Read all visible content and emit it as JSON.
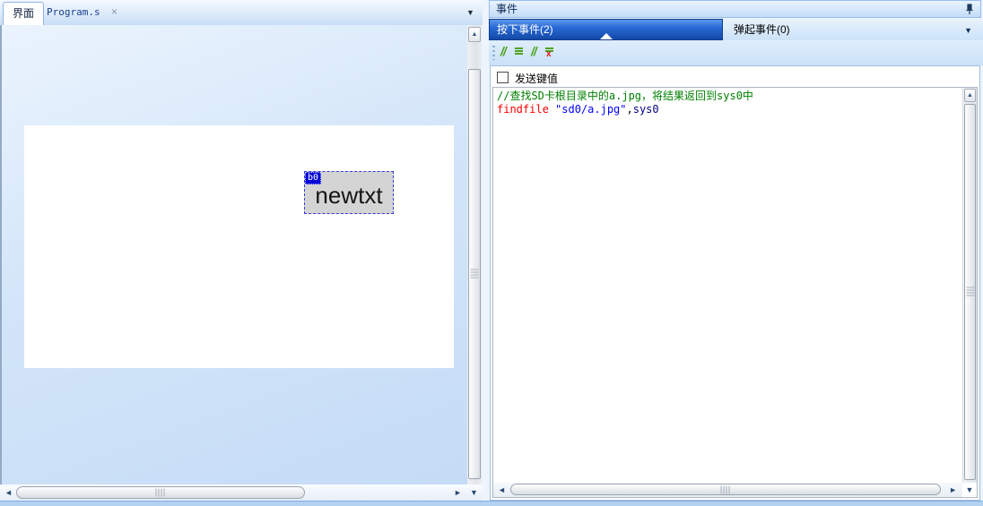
{
  "icons": {
    "up": "▲",
    "down": "▼",
    "left": "◄",
    "right": "►",
    "close": "×"
  },
  "left_panel": {
    "tabs": [
      {
        "label": "界面",
        "active": true
      },
      {
        "label": "Program.s",
        "active": false
      }
    ],
    "canvas": {
      "widget": {
        "id_badge": "b0",
        "text": "newtxt"
      }
    }
  },
  "right_panel": {
    "title": "事件",
    "tabs": [
      {
        "label": "按下事件(2)",
        "active": true
      },
      {
        "label": "弹起事件(0)",
        "active": false
      }
    ],
    "toolbar": {
      "comment_glyph": "//",
      "uncomment_glyph": "//",
      "uncomment_x": "x"
    },
    "send_key_checkbox": {
      "label": "发送键值",
      "checked": false
    },
    "code": {
      "lines": [
        {
          "segments": [
            {
              "text": "//查找SD卡根目录中的a.jpg，将结果返回到sys0中",
              "color": "#008000"
            }
          ]
        },
        {
          "segments": [
            {
              "text": "findfile",
              "color": "#FF0000"
            },
            {
              "text": " \"sd0/a.jpg\"",
              "color": "#0000FF"
            },
            {
              "text": ",",
              "color": "#000000"
            },
            {
              "text": "sys0",
              "color": "#000080"
            }
          ]
        }
      ]
    }
  },
  "colors": {
    "selected_tab_blue": "#1C5CC8",
    "panel_bg": "#CFE3FA",
    "widget_fill": "#D4D4D4",
    "badge_blue": "#0505D8",
    "comment_green": "#008000",
    "keyword_red": "#FF0000",
    "string_blue": "#0000FF",
    "sysvar_navy": "#000080",
    "toolbar_icon_green": "#4EA31F"
  }
}
